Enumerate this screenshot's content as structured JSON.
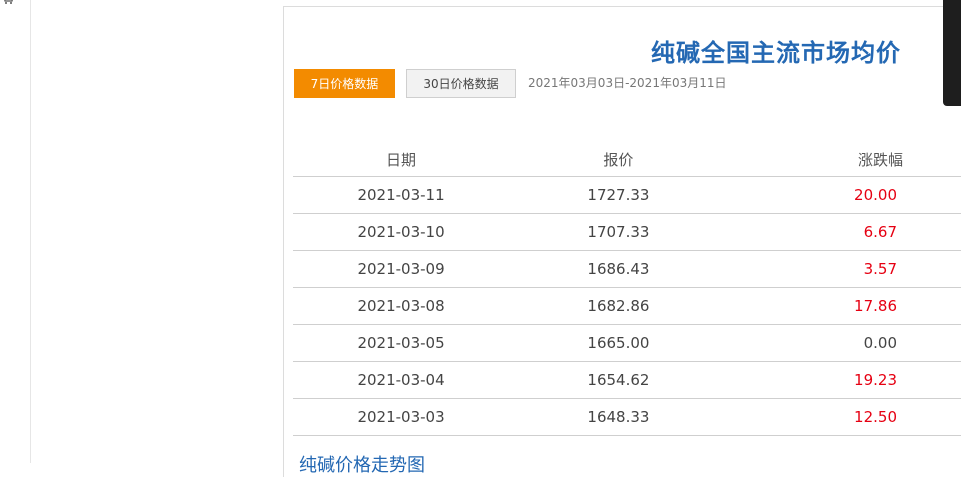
{
  "page": {
    "title": "纯碱全国主流市场均价",
    "left_icon": "shopping-cart-icon"
  },
  "tabs": {
    "seven_day": "7日价格数据",
    "thirty_day": "30日价格数据",
    "active": "7日价格数据",
    "active_color": "#f38b00"
  },
  "date_range": "2021年03月03日-2021年03月11日",
  "table": {
    "headers": [
      "日期",
      "报价",
      "涨跌幅"
    ],
    "rows": [
      {
        "date": "2021-03-11",
        "price": "1727.33",
        "change": "20.00"
      },
      {
        "date": "2021-03-10",
        "price": "1707.33",
        "change": "6.67"
      },
      {
        "date": "2021-03-09",
        "price": "1686.43",
        "change": "3.57"
      },
      {
        "date": "2021-03-08",
        "price": "1682.86",
        "change": "17.86"
      },
      {
        "date": "2021-03-05",
        "price": "1665.00",
        "change": "0.00"
      },
      {
        "date": "2021-03-04",
        "price": "1654.62",
        "change": "19.23"
      },
      {
        "date": "2021-03-03",
        "price": "1648.33",
        "change": "12.50"
      }
    ],
    "up_color": "#e60012"
  },
  "heatmap_link": "纯碱价格走势图"
}
